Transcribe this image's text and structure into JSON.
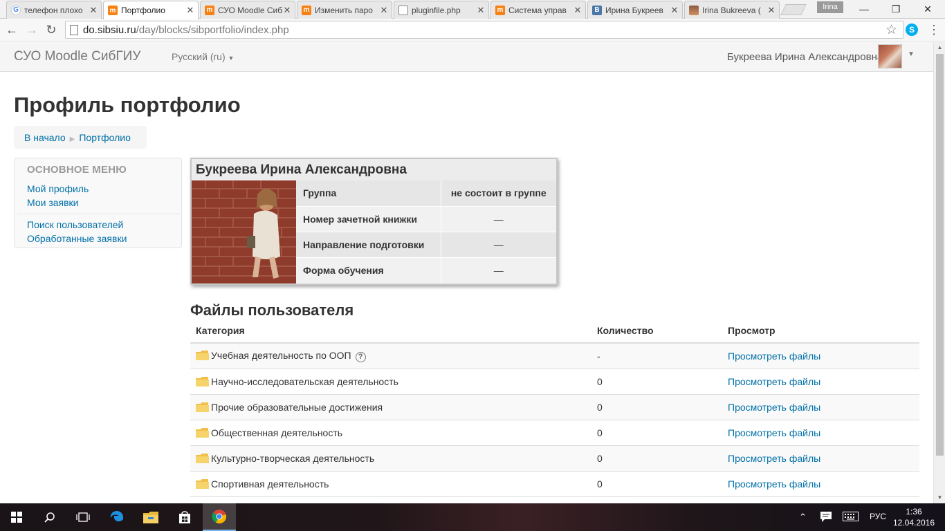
{
  "browser": {
    "tabs": [
      {
        "title": "телефон плохо",
        "icon": "google-icon",
        "active": false
      },
      {
        "title": "Портфолио",
        "icon": "moodle-icon",
        "active": true
      },
      {
        "title": "СУО Moodle Сиб",
        "icon": "moodle-icon",
        "active": false
      },
      {
        "title": "Изменить паро",
        "icon": "moodle-icon",
        "active": false
      },
      {
        "title": "pluginfile.php",
        "icon": "document-icon",
        "active": false
      },
      {
        "title": "Система управ",
        "icon": "moodle-icon",
        "active": false
      },
      {
        "title": "Ирина Букреев",
        "icon": "vk-icon",
        "active": false
      },
      {
        "title": "Irina Bukreeva (",
        "icon": "instagram-icon",
        "active": false
      }
    ],
    "profile_name": "Irina",
    "url_host": "do.sibsiu.ru",
    "url_path": "/day/blocks/sibportfolio/index.php"
  },
  "navbar": {
    "brand": "СУО Moodle СибГИУ",
    "language": "Русский (ru)",
    "user_name": "Букреева Ирина Александровна"
  },
  "page": {
    "title": "Профиль портфолио",
    "breadcrumb": [
      "В начало",
      "Портфолио"
    ]
  },
  "sidebar": {
    "title": "ОСНОВНОЕ МЕНЮ",
    "group1": [
      "Мой профиль",
      "Мои заявки"
    ],
    "group2": [
      "Поиск пользователей",
      "Обработанные заявки"
    ]
  },
  "profile": {
    "name": "Букреева Ирина Александровна",
    "rows": [
      {
        "label": "Группа",
        "value": "не состоит в группе"
      },
      {
        "label": "Номер зачетной книжки",
        "value": "—"
      },
      {
        "label": "Направление подготовки",
        "value": "—"
      },
      {
        "label": "Форма обучения",
        "value": "—"
      }
    ]
  },
  "files": {
    "title": "Файлы пользователя",
    "headers": {
      "category": "Категория",
      "count": "Количество",
      "view": "Просмотр"
    },
    "rows": [
      {
        "category": "Учебная деятельность по ООП",
        "count": "-",
        "view": "Просмотреть файлы",
        "help": "?"
      },
      {
        "category": "Научно-исследовательская деятельность",
        "count": "0",
        "view": "Просмотреть файлы"
      },
      {
        "category": "Прочие образовательные достижения",
        "count": "0",
        "view": "Просмотреть файлы"
      },
      {
        "category": "Общественная деятельность",
        "count": "0",
        "view": "Просмотреть файлы"
      },
      {
        "category": "Культурно-творческая деятельность",
        "count": "0",
        "view": "Просмотреть файлы"
      },
      {
        "category": "Спортивная деятельность",
        "count": "0",
        "view": "Просмотреть файлы"
      }
    ]
  },
  "taskbar": {
    "language": "РУС",
    "time": "1:36",
    "date": "12.04.2016"
  },
  "colors": {
    "link": "#0070a8",
    "navbar_bg": "#f5f5f5",
    "card_bg": "#ececec"
  }
}
